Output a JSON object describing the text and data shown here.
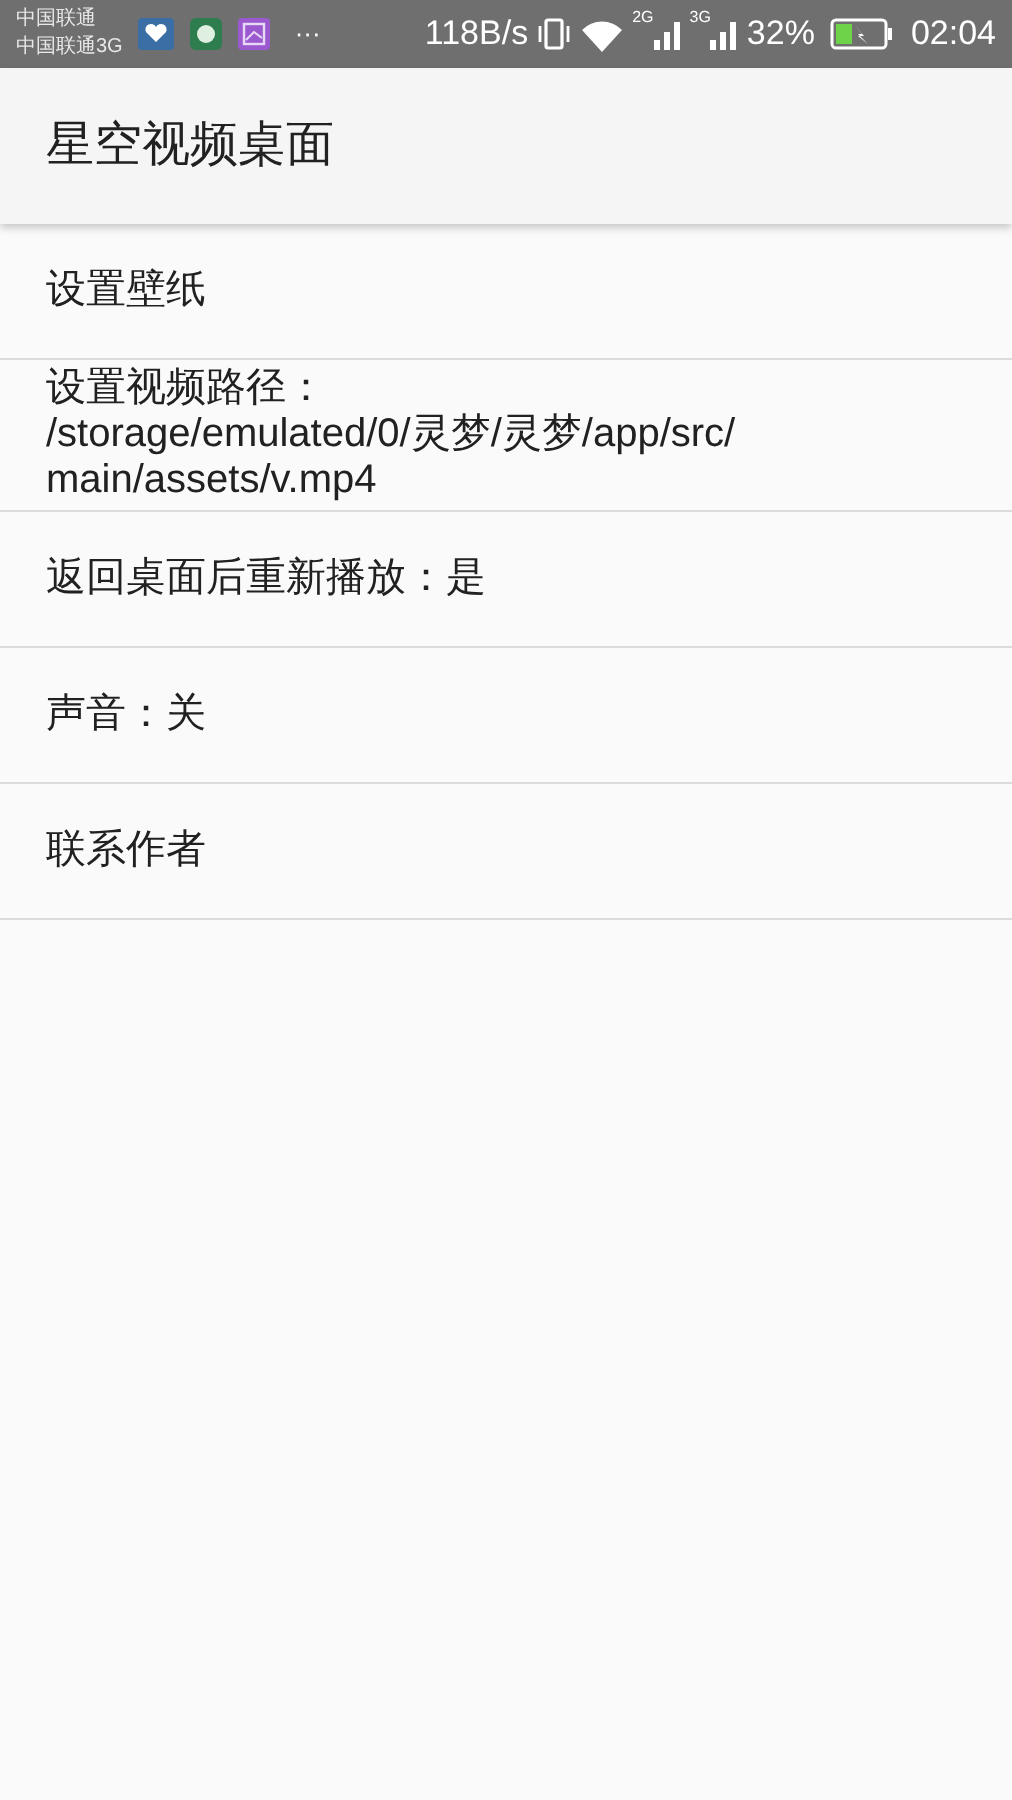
{
  "status_bar": {
    "carrier_1": "中国联通",
    "carrier_2": "中国联通3G",
    "more": "···",
    "speed": "118B/s",
    "signal_1_label": "2G",
    "signal_2_label": "3G",
    "battery": "32%",
    "time": "02:04"
  },
  "app_bar": {
    "title": "星空视频桌面"
  },
  "settings": [
    {
      "text": "设置壁纸"
    },
    {
      "text": "设置视频路径：\n/storage/emulated/0/灵梦/灵梦/app/src/\nmain/assets/v.mp4"
    },
    {
      "text": "返回桌面后重新播放：是"
    },
    {
      "text": "声音：关"
    },
    {
      "text": "联系作者"
    }
  ]
}
